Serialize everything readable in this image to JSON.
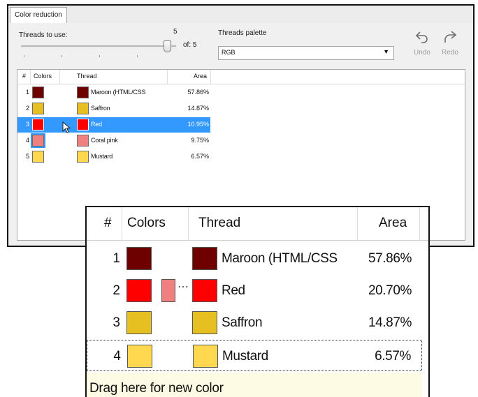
{
  "dialog": {
    "tab_label": "Color reduction",
    "threads_label": "Threads to use:",
    "slider_value": "5",
    "of_label": "of: 5",
    "palette_label": "Threads palette",
    "palette_value": "RGB",
    "undo_label": "Undo",
    "redo_label": "Redo",
    "columns": {
      "num": "#",
      "colors": "Colors",
      "thread": "Thread",
      "area": "Area"
    },
    "rows": [
      {
        "num": "1",
        "color": "#6e0000",
        "thread": "Maroon (HTML/CSS",
        "area": "57.86%"
      },
      {
        "num": "2",
        "color": "#e6c020",
        "thread": "Saffron",
        "area": "14.87%"
      },
      {
        "num": "3",
        "color": "#ff0000",
        "thread": "Red",
        "area": "10.95%"
      },
      {
        "num": "4",
        "color": "#f08080",
        "thread": "Coral pink",
        "area": "9.75%"
      },
      {
        "num": "5",
        "color": "#ffd850",
        "thread": "Mustard",
        "area": "6.57%"
      }
    ],
    "selected_row": 2
  },
  "zoom": {
    "columns": {
      "num": "#",
      "colors": "Colors",
      "thread": "Thread",
      "area": "Area"
    },
    "rows": [
      {
        "num": "1",
        "color": "#6e0000",
        "thread": "Maroon (HTML/CSS",
        "area": "57.86%"
      },
      {
        "num": "2",
        "color": "#ff0000",
        "extra_color": "#f08080",
        "thread": "Red",
        "area": "20.70%"
      },
      {
        "num": "3",
        "color": "#e6c020",
        "thread": "Saffron",
        "area": "14.87%"
      },
      {
        "num": "4",
        "color": "#ffd850",
        "thread": "Mustard",
        "area": "6.57%"
      }
    ],
    "drop_hint": "Drag here for new color"
  },
  "icons": {
    "undo": "undo-icon",
    "redo": "redo-icon",
    "dropdown": "chevron-down-icon",
    "cursor": "mouse-pointer-icon"
  }
}
